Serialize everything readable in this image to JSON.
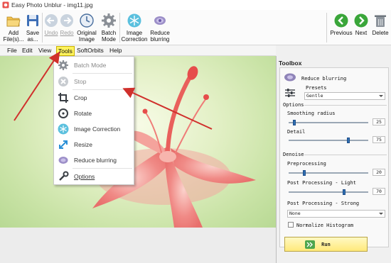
{
  "window": {
    "title": "Easy Photo Unblur - img11.jpg"
  },
  "ribbon": {
    "add_files": "Add\nFile(s)...",
    "add_files_l1": "Add",
    "add_files_l2": "File(s)...",
    "save_as_l1": "Save",
    "save_as_l2": "as...",
    "undo": "Undo",
    "redo": "Redo",
    "original_image_l1": "Original",
    "original_image_l2": "Image",
    "batch_mode_l1": "Batch",
    "batch_mode_l2": "Mode",
    "image_correction_l1": "Image",
    "image_correction_l2": "Correction",
    "reduce_blurring_l1": "Reduce",
    "reduce_blurring_l2": "blurring",
    "previous": "Previous",
    "next": "Next",
    "delete": "Delete"
  },
  "menu": {
    "file": "File",
    "edit": "Edit",
    "view": "View",
    "tools": "Tools",
    "softorbits": "SoftOrbits",
    "help": "Help"
  },
  "tools_menu": {
    "items": [
      {
        "label": "Batch Mode",
        "icon": "gear-icon",
        "disabled": true
      },
      {
        "label": "Stop",
        "icon": "stop-icon",
        "disabled": true
      },
      {
        "label": "Crop",
        "icon": "crop-icon",
        "disabled": false
      },
      {
        "label": "Rotate",
        "icon": "rotate-icon",
        "disabled": false
      },
      {
        "label": "Image Correction",
        "icon": "snowflake-icon",
        "disabled": false
      },
      {
        "label": "Resize",
        "icon": "resize-icon",
        "disabled": false
      },
      {
        "label": "Reduce blurring",
        "icon": "blur-icon",
        "disabled": false
      },
      {
        "label": "Options",
        "icon": "wrench-icon",
        "disabled": false
      }
    ]
  },
  "toolbox": {
    "title": "Toolbox",
    "tool_name": "Reduce blurring",
    "presets_label": "Presets",
    "preset_value": "Gentle",
    "options_label": "Options",
    "smoothing_radius_label": "Smoothing radius",
    "smoothing_radius_value": "25",
    "smoothing_radius_level": 0.07,
    "detail_label": "Detail",
    "detail_value": "75",
    "detail_level": 0.75,
    "denoise_label": "Denoise",
    "preprocessing_label": "Preprocessing",
    "preprocessing_value": "20",
    "preprocessing_level": 0.2,
    "post_light_label": "Post Processing - Light",
    "post_light_value": "70",
    "post_light_level": 0.7,
    "post_strong_label": "Post Processing - Strong",
    "post_strong_value": "None",
    "normalize_label": "Normalize Histogram",
    "normalize_checked": false,
    "run_label": "Run"
  },
  "colors": {
    "accent_red": "#d0302c",
    "menu_highlight": "#fff35c",
    "nav_green": "#3aa63a",
    "thumb_blue": "#2f6fb3"
  }
}
